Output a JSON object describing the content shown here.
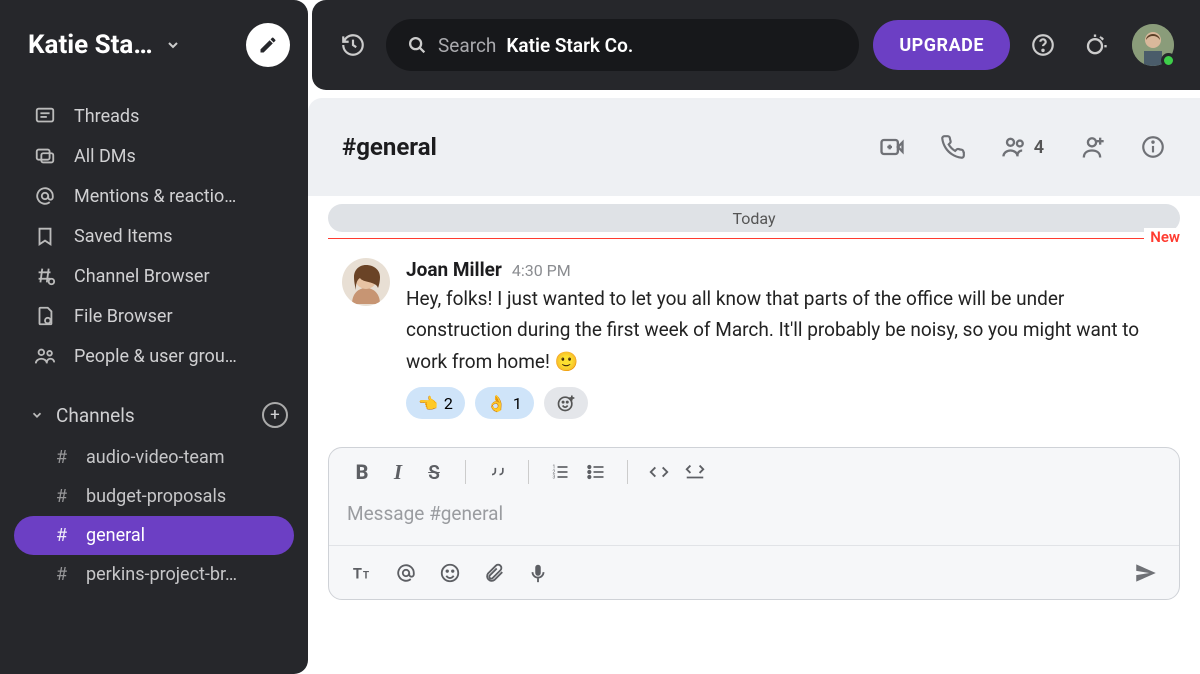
{
  "workspace": {
    "name": "Katie Sta…"
  },
  "topbar": {
    "search_label": "Search",
    "search_value": "Katie Stark Co.",
    "upgrade_label": "UPGRADE"
  },
  "nav": {
    "threads": "Threads",
    "all_dms": "All DMs",
    "mentions": "Mentions & reactio…",
    "saved": "Saved Items",
    "channel_browser": "Channel Browser",
    "file_browser": "File Browser",
    "people": "People & user grou…"
  },
  "channels": {
    "label": "Channels",
    "items": [
      "audio-video-team",
      "budget-proposals",
      "general",
      "perkins-project-br…"
    ],
    "active_index": 2
  },
  "channel_header": {
    "name": "#general",
    "member_count": "4"
  },
  "date_separator": "Today",
  "new_marker": "New",
  "message": {
    "author": "Joan Miller",
    "time": "4:30 PM",
    "text": "Hey, folks! I just wanted to let you all know that parts of the office will be under construction during the first week of March. It'll probably be noisy, so you might want to work from home! 🙂",
    "reactions": [
      {
        "emoji": "👈",
        "count": "2"
      },
      {
        "emoji": "👌",
        "count": "1"
      }
    ]
  },
  "composer": {
    "placeholder": "Message #general"
  }
}
